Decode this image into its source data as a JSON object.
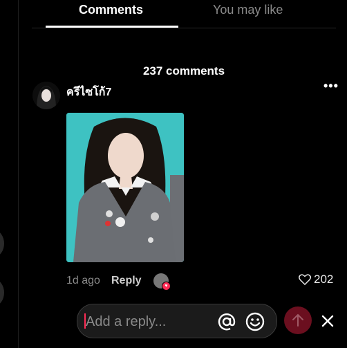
{
  "tabs": [
    {
      "label": "Comments"
    },
    {
      "label": "You may like"
    }
  ],
  "comments_count": "237 comments",
  "comment": {
    "username": "ครีไซโก้7",
    "time": "1d ago",
    "reply_label": "Reply",
    "likes": "202"
  },
  "reply_box": {
    "placeholder": "Add a reply..."
  },
  "colors": {
    "accent": "#fe2c55",
    "send_button": "#6b0f1f",
    "photo_background": "#3ec2c2"
  }
}
